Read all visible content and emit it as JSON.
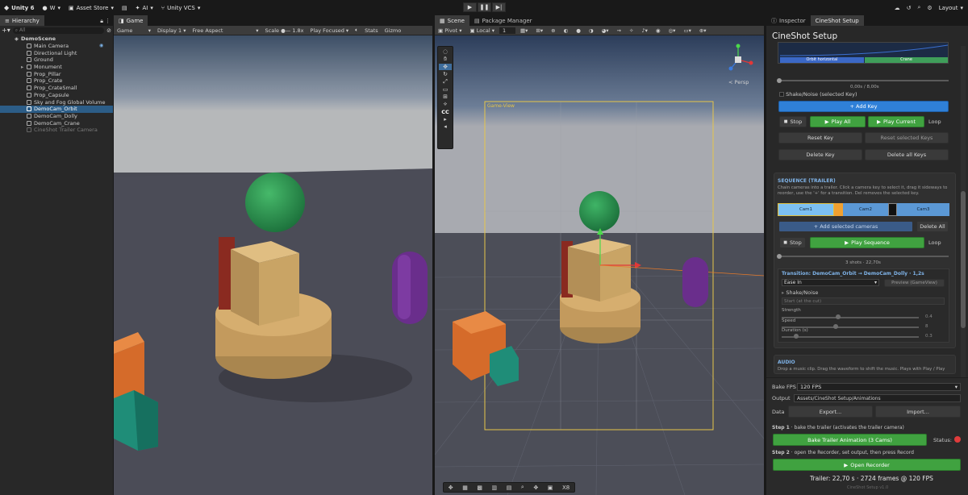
{
  "topbar": {
    "product": "Unity 6",
    "account": "W",
    "asset_store": "Asset Store",
    "ai": "AI",
    "vcs": "Unity VCS",
    "layout": "Layout"
  },
  "hierarchy": {
    "tab": "Hierarchy",
    "search_placeholder": "All",
    "scene": "DemoScene",
    "items": [
      {
        "label": "Main Camera"
      },
      {
        "label": "Directional Light"
      },
      {
        "label": "Ground"
      },
      {
        "label": "Monument"
      },
      {
        "label": "Prop_Pillar"
      },
      {
        "label": "Prop_Crate"
      },
      {
        "label": "Prop_CrateSmall"
      },
      {
        "label": "Prop_Capsule"
      },
      {
        "label": "Sky and Fog Global Volume"
      },
      {
        "label": "DemoCam_Orbit"
      },
      {
        "label": "DemoCam_Dolly"
      },
      {
        "label": "DemoCam_Crane"
      },
      {
        "label": "CineShot Trailer Camera"
      }
    ]
  },
  "game": {
    "tab": "Game",
    "mode": "Game",
    "display": "Display 1",
    "aspect": "Free Aspect",
    "scale_label": "Scale",
    "scale_value": "1.8x",
    "play_mode": "Play Focused",
    "stats": "Stats",
    "gizmos": "Gizmo"
  },
  "scene": {
    "tab_scene": "Scene",
    "tab_package": "Package Manager",
    "pivot": "Pivot",
    "local": "Local",
    "grid_value": "1",
    "persp": "< Persp",
    "game_view_label": "Game-View",
    "cc": "CC",
    "bottom_value": "X8"
  },
  "inspector": {
    "tab_inspector": "Inspector",
    "tab_cineshot": "CineShot Setup",
    "title": "CineShot Setup",
    "timeline_orbit": "Orbit horizontal",
    "timeline_crane": "Crane",
    "time_readout": "0,00s / 8,00s",
    "shake_noise_key": "Shake/Noise (selected Key)",
    "add_key": "+ Add Key",
    "stop": "Stop",
    "play_all": "Play All",
    "play_current": "Play Current",
    "loop": "Loop",
    "reset_key": "Reset Key",
    "reset_selected": "Reset selected Keys",
    "delete_key": "Delete Key",
    "delete_all_keys": "Delete all Keys",
    "sequence_title": "SEQUENCE (TRAILER)",
    "sequence_help_1": "Chain cameras into a trailer. Click a camera key to select it, drag it sideways to",
    "sequence_help_2": "reorder, use the '+' for a transition. Del removes the selected key.",
    "cams": [
      "Cam1",
      "Cam2",
      "Cam3"
    ],
    "add_selected": "+ Add selected cameras",
    "delete_all": "Delete All",
    "play_sequence": "Play Sequence",
    "shots_info": "3 shots  ·  22,70s",
    "transition_label": "Transition:",
    "transition_from": "DemoCam_Orbit",
    "transition_to": "DemoCam_Dolly",
    "transition_duration": "1,2s",
    "ease": "Ease In",
    "preview": "Preview (GameView)",
    "shake_noise": "Shake/Noise",
    "start_cut": "Start (at the cut)",
    "strength": "Strength",
    "strength_value": "0.4",
    "speed": "Speed",
    "speed_value": "8",
    "duration": "Duration (s)",
    "duration_value": "0.3",
    "audio_title": "AUDIO",
    "audio_help": "Drop a music clip. Drag the waveform to shift the music. Plays with Play / Play",
    "bake_fps_label": "Bake FPS",
    "bake_fps_value": "120 FPS",
    "output_label": "Output",
    "output_value": "Assets/CineShot Setup/Animations",
    "data_label": "Data",
    "export": "Export...",
    "import": "Import...",
    "step1_label": "Step 1",
    "step1_text": "bake the trailer (activates the trailer camera)",
    "bake_button": "Bake Trailer Animation (3 Cams)",
    "status_label": "Status:",
    "step2_label": "Step 2",
    "step2_text": "open the Recorder, set output, then press Record",
    "open_recorder": "Open Recorder",
    "trailer_summary": "Trailer: 22,70 s  ·  2724 frames @ 120 FPS",
    "footer": "CineShot Setup v1.0"
  },
  "colors": {
    "accent_blue": "#2f80d8",
    "accent_green": "#40a240",
    "selection": "#2c5d87",
    "status_red": "#e03c3c"
  }
}
